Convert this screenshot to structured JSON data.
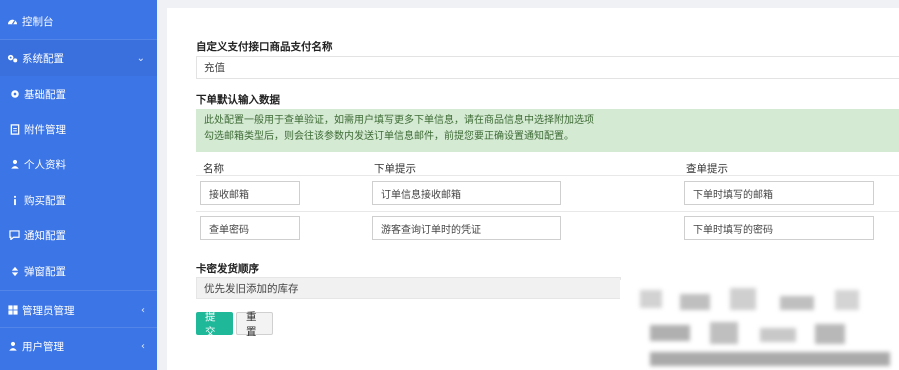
{
  "sidebar": {
    "items": [
      {
        "label": "控制台",
        "icon": "dashboard-icon"
      },
      {
        "label": "系统配置",
        "icon": "gears-icon",
        "chevron": "⌄"
      },
      {
        "label": "基础配置",
        "icon": "gear-icon"
      },
      {
        "label": "附件管理",
        "icon": "file-icon"
      },
      {
        "label": "个人资料",
        "icon": "user-icon"
      },
      {
        "label": "购买配置",
        "icon": "info-icon"
      },
      {
        "label": "通知配置",
        "icon": "comment-icon"
      },
      {
        "label": "弹窗配置",
        "icon": "sort-icon"
      },
      {
        "label": "管理员管理",
        "icon": "windows-icon",
        "chevron": "‹"
      },
      {
        "label": "用户管理",
        "icon": "user-icon",
        "chevron": "‹"
      }
    ]
  },
  "form": {
    "pay_name_label": "自定义支付接口商品支付名称",
    "pay_name_value": "充值",
    "order_input_label": "下单默认输入数据",
    "notice_line1": "此处配置一般用于查单验证，如需用户填写更多下单信息，请在商品信息中选择附加选项",
    "notice_line2": "勾选邮箱类型后，则会往该参数内发送订单信息邮件，前提您要正确设置通知配置。",
    "table": {
      "headers": [
        "名称",
        "下单提示",
        "查单提示"
      ],
      "rows": [
        [
          "接收邮箱",
          "订单信息接收邮箱",
          "下单时填写的邮箱"
        ],
        [
          "查单密码",
          "游客查询订单时的凭证",
          "下单时填写的密码"
        ]
      ]
    },
    "card_order_label": "卡密发货顺序",
    "card_order_value": "优先发旧添加的库存",
    "submit_label": "提交",
    "reset_label": "重置"
  },
  "colors": {
    "sidebar": "#3c75e6",
    "primary_button": "#1fb99a",
    "notice_bg": "#d5ead3"
  }
}
